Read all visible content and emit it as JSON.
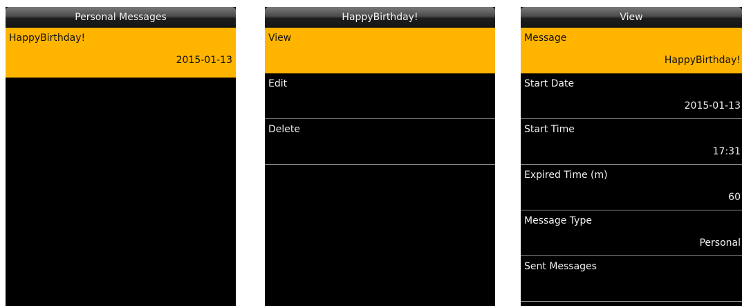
{
  "colors": {
    "highlight": "#ffb400",
    "background": "#000000",
    "text": "#f0f0f0"
  },
  "screen1": {
    "title": "Personal Messages",
    "items": [
      {
        "label": "HappyBirthday!",
        "value": "2015-01-13"
      }
    ]
  },
  "screen2": {
    "title": "HappyBirthday!",
    "items": [
      {
        "label": "View"
      },
      {
        "label": "Edit"
      },
      {
        "label": "Delete"
      }
    ]
  },
  "screen3": {
    "title": "View",
    "items": [
      {
        "label": "Message",
        "value": "HappyBirthday!"
      },
      {
        "label": "Start Date",
        "value": "2015-01-13"
      },
      {
        "label": "Start Time",
        "value": "17:31"
      },
      {
        "label": "Expired Time (m)",
        "value": "60"
      },
      {
        "label": "Message Type",
        "value": "Personal"
      },
      {
        "label": "Sent Messages"
      }
    ]
  }
}
